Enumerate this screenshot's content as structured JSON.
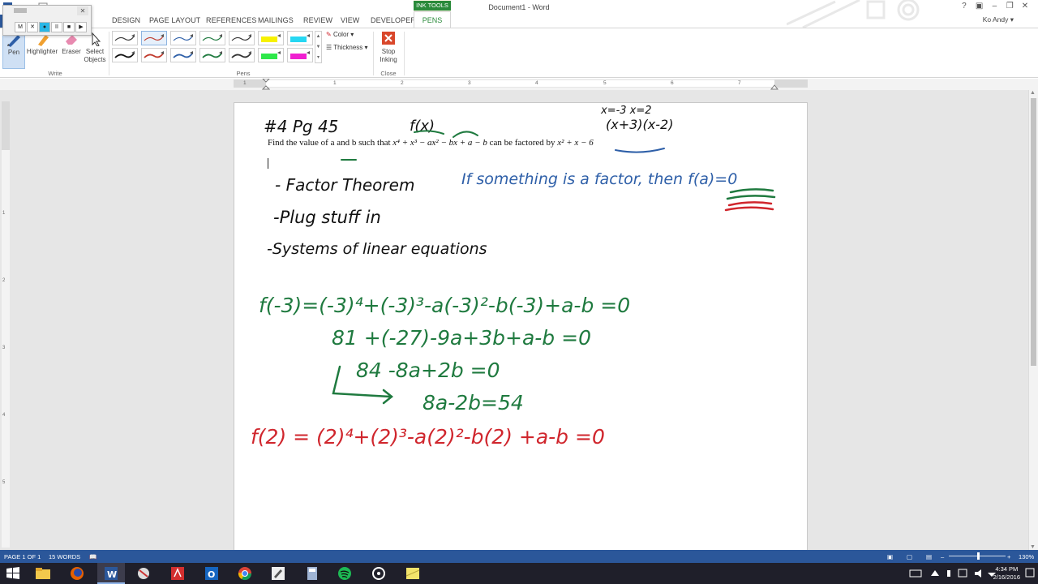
{
  "window": {
    "title": "Document1 - Word",
    "user": "Ko Andy"
  },
  "tabs": [
    {
      "label": "DESIGN"
    },
    {
      "label": "PAGE LAYOUT"
    },
    {
      "label": "REFERENCES"
    },
    {
      "label": "MAILINGS"
    },
    {
      "label": "REVIEW"
    },
    {
      "label": "VIEW"
    },
    {
      "label": "DEVELOPER"
    }
  ],
  "contextual": {
    "group": "INK TOOLS",
    "tab": "PENS"
  },
  "ribbon": {
    "write_buttons": [
      {
        "label": "Pen"
      },
      {
        "label": "Highlighter"
      },
      {
        "label": "Eraser"
      },
      {
        "label": "Select Objects"
      }
    ],
    "write_group": "Write",
    "pens_group": "Pens",
    "color_label": "Color",
    "thickness_label": "Thickness",
    "stop_label": "Stop Inking",
    "close_group": "Close"
  },
  "pen_colors": {
    "row1": [
      "#333333",
      "#c0392b",
      "#2e5fa8",
      "#1f7a3f",
      "#333333",
      "#f7f100",
      "#26d7f2"
    ],
    "row2": [
      "#111111",
      "#c0392b",
      "#2e5fa8",
      "#1f7a3f",
      "#333333",
      "#2ee84a",
      "#f020d0"
    ]
  },
  "inkbar": {
    "buttons": [
      "M",
      "✕",
      "●",
      "II",
      "■",
      "▶"
    ]
  },
  "ruler": {
    "numbers": [
      "1",
      "1",
      "2",
      "3",
      "4",
      "5",
      "6",
      "7"
    ]
  },
  "vruler": {
    "numbers": [
      "1",
      "2",
      "3",
      "4",
      "5"
    ]
  },
  "document": {
    "typed_text": {
      "prefix": "Find the value of a and b such that ",
      "poly": "x⁴ + x³ − ax² − bx + a − b",
      "mid": " can be factored by ",
      "factor": "x² + x − 6"
    },
    "ink": {
      "header_left": "#4    Pg 45",
      "header_f": "f(x) ",
      "roots": "x=-3    x=2",
      "factors": "(x+3)(x-2)",
      "method1": "- Factor Theorem",
      "method1_note": "If something is a factor, then f(a)=0",
      "method2": "-Plug stuff in",
      "method3": "-Systems of linear equations",
      "eq1": "f(-3)=(-3)⁴+(-3)³-a(-3)²-b(-3)+a-b =0",
      "eq2": "81 +(-27)-9a+3b+a-b =0",
      "eq3": "84 -8a+2b =0",
      "eq4": "8a-2b=54",
      "eq5": "f(2) = (2)⁴+(2)³-a(2)²-b(2) +a-b =0"
    }
  },
  "status": {
    "page": "PAGE 1 OF 1",
    "words": "15 WORDS",
    "zoom": "130%"
  },
  "clock": {
    "time": "4:34 PM",
    "date": "2/16/2016"
  },
  "colors": {
    "word_blue": "#2b579a",
    "ink_green": "#1f7a3f",
    "ink_blue": "#2e5fa8",
    "ink_red": "#d0262d",
    "ink_black": "#111111"
  }
}
